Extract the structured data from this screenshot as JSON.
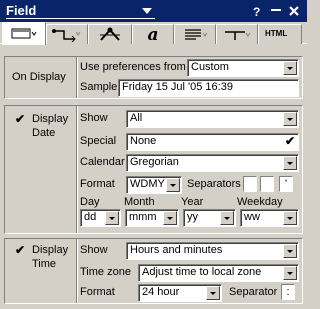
{
  "window": {
    "title": "Field"
  },
  "tabs": [
    {
      "name": "general"
    },
    {
      "name": "connectors"
    },
    {
      "name": "picture"
    },
    {
      "name": "text"
    },
    {
      "name": "paragraph"
    },
    {
      "name": "tabs"
    },
    {
      "name": "html",
      "label": "HTML"
    }
  ],
  "on_display": {
    "section_label": "On Display",
    "use_preferences_label": "Use preferences from",
    "use_preferences_value": "Custom",
    "sample_label": "Sample",
    "sample_value": "Friday 15 Jul '05 16:39"
  },
  "display_date": {
    "checked": "✔",
    "section_label_line1": "Display",
    "section_label_line2": "Date",
    "show_label": "Show",
    "show_value": "All",
    "special_label": "Special",
    "special_value": "None",
    "special_check": "✔",
    "calendar_label": "Calendar",
    "calendar_value": "Gregorian",
    "format_label": "Format",
    "format_value": "WDMY",
    "separators_label": "Separators",
    "separator_1": "",
    "separator_2": "",
    "separator_3": "'",
    "day_label": "Day",
    "day_value": "dd",
    "month_label": "Month",
    "month_value": "mmm",
    "year_label": "Year",
    "year_value": "yy",
    "weekday_label": "Weekday",
    "weekday_value": "ww"
  },
  "display_time": {
    "checked": "✔",
    "section_label_line1": "Display",
    "section_label_line2": "Time",
    "show_label": "Show",
    "show_value": "Hours and minutes",
    "timezone_label": "Time zone",
    "timezone_value": "Adjust time to local zone",
    "format_label": "Format",
    "format_value": "24 hour",
    "separator_label": "Separator",
    "separator_value": ":"
  }
}
